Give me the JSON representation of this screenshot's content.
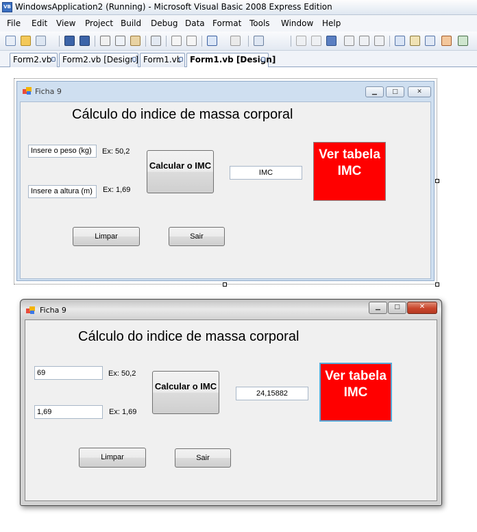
{
  "window": {
    "title": "WindowsApplication2 (Running) - Microsoft Visual Basic 2008 Express Edition",
    "icon_text": "VB"
  },
  "menu": [
    "File",
    "Edit",
    "View",
    "Project",
    "Build",
    "Debug",
    "Data",
    "Format",
    "Tools",
    "Window",
    "Help"
  ],
  "tabs": [
    {
      "label": "Form2.vb",
      "active": false
    },
    {
      "label": "Form2.vb [Design]",
      "active": false
    },
    {
      "label": "Form1.vb",
      "active": false
    },
    {
      "label": "Form1.vb [Design]",
      "active": true
    }
  ],
  "design_form": {
    "title": "Ficha 9",
    "heading": "Cálculo do indice de massa corporal",
    "peso_input": "Insere o peso (kg)",
    "peso_example": "Ex: 50,2",
    "altura_input": "Insere a altura (m)",
    "altura_example": "Ex: 1,69",
    "calc_button": "Calcular o IMC",
    "imc_output": "IMC",
    "tabela_button": "Ver tabela IMC",
    "limpar_button": "Limpar",
    "sair_button": "Sair"
  },
  "run_form": {
    "title": "Ficha 9",
    "heading": "Cálculo do indice de massa corporal",
    "peso_input": "69",
    "peso_example": "Ex: 50,2",
    "altura_input": "1,69",
    "altura_example": "Ex: 1,69",
    "calc_button": "Calcular o IMC",
    "imc_output": "24,15882",
    "tabela_button": "Ver tabela IMC",
    "limpar_button": "Limpar",
    "sair_button": "Sair"
  },
  "colors": {
    "red_button": "#ff0000",
    "red_button_text": "#ffffff",
    "close_button": "#c9462c"
  },
  "toolbar_icons": [
    "add-item-icon",
    "open-icon",
    "add-icon",
    "save-icon",
    "save-all-icon",
    "cut-icon",
    "copy-icon",
    "paste-icon",
    "find-icon",
    "comment-icon",
    "uncomment-icon",
    "undo-icon",
    "redo-icon",
    "navigate-icon",
    "start-icon",
    "pause-icon",
    "stop-icon",
    "step-into-icon",
    "step-over-icon",
    "step-out-icon",
    "solution-explorer-icon",
    "properties-icon",
    "object-browser-icon",
    "toolbox-icon",
    "options-icon"
  ]
}
